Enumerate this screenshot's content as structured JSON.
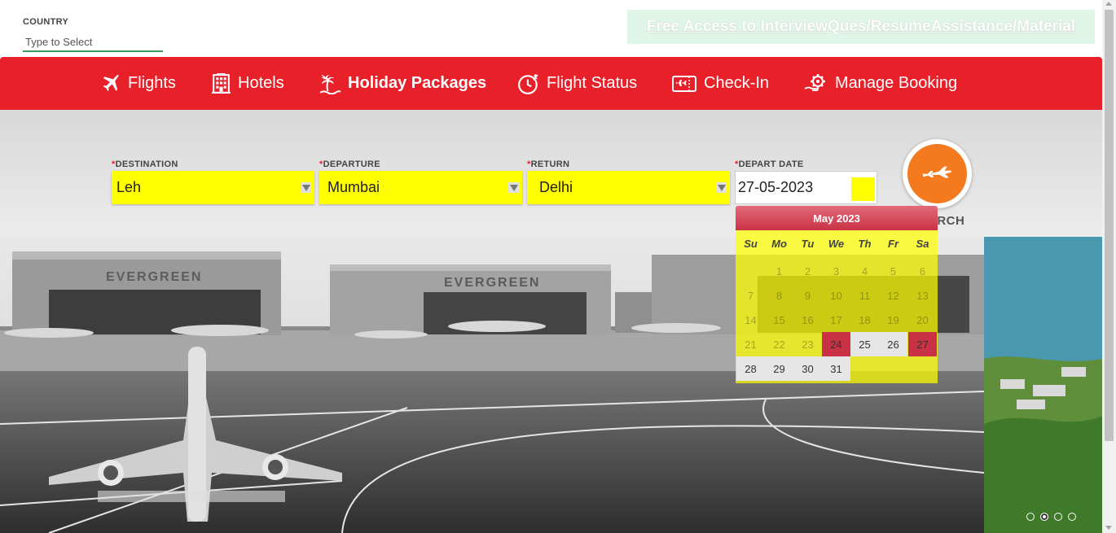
{
  "country": {
    "label": "COUNTRY",
    "placeholder": "Type to Select"
  },
  "promo": {
    "text": "Free Access to InterviewQues/ResumeAssistance/Material"
  },
  "nav": {
    "items": [
      {
        "label": "Flights",
        "icon": "plane-icon"
      },
      {
        "label": "Hotels",
        "icon": "building-icon"
      },
      {
        "label": "Holiday Packages",
        "icon": "palm-island-icon"
      },
      {
        "label": "Flight Status",
        "icon": "clock-plane-icon"
      },
      {
        "label": "Check-In",
        "icon": "ticket-plane-icon"
      },
      {
        "label": "Manage Booking",
        "icon": "gear-hand-icon"
      }
    ],
    "active": "Holiday Packages"
  },
  "form": {
    "destination": {
      "label": "DESTINATION",
      "value": "Leh"
    },
    "departure": {
      "label": "DEPARTURE",
      "value": "Mumbai"
    },
    "return": {
      "label": "RETURN",
      "value": "Delhi"
    },
    "depart_date": {
      "label": "DEPART DATE",
      "value": "27-05-2023"
    },
    "required_mark": "*",
    "search_label": "SEARCH"
  },
  "datepicker": {
    "month_title": "May 2023",
    "weekdays": [
      "Su",
      "Mo",
      "Tu",
      "We",
      "Th",
      "Fr",
      "Sa"
    ],
    "weeks": [
      [
        "",
        "1",
        "2",
        "3",
        "4",
        "5",
        "6"
      ],
      [
        "7",
        "8",
        "9",
        "10",
        "11",
        "12",
        "13"
      ],
      [
        "14",
        "15",
        "16",
        "17",
        "18",
        "19",
        "20"
      ],
      [
        "21",
        "22",
        "23",
        "24",
        "25",
        "26",
        "27"
      ],
      [
        "28",
        "29",
        "30",
        "31",
        "",
        "",
        ""
      ]
    ],
    "today": "24",
    "selected": "27",
    "first_enabled": 24
  },
  "carousel": {
    "slide_count": 4,
    "active_index": 1
  },
  "colors": {
    "nav_red": "#e8202a",
    "highlight_yellow": "#ffff00",
    "search_orange": "#f47a1f",
    "calendar_red": "#c93245",
    "promo_bg": "#dff5e8"
  }
}
